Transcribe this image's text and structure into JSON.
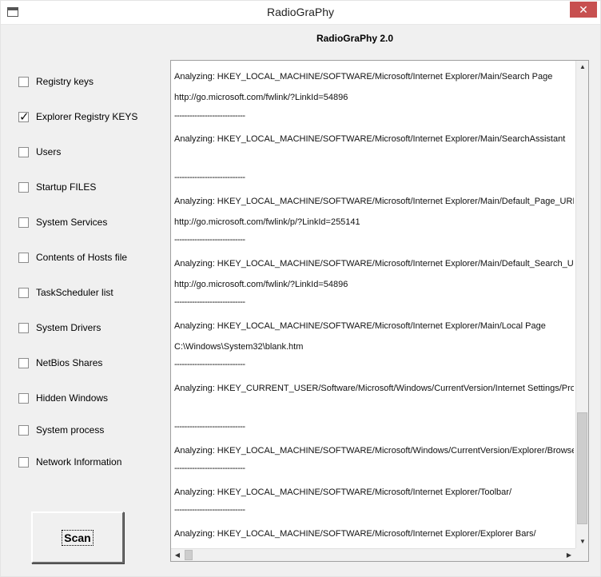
{
  "window": {
    "title": "RadioGraPhy",
    "close_glyph": "✕",
    "icon": "window-icon"
  },
  "header": {
    "title": "RadioGraPhy 2.0"
  },
  "options": [
    {
      "label": "Registry keys",
      "checked": false
    },
    {
      "label": "Explorer Registry KEYS",
      "checked": true
    },
    {
      "label": "Users",
      "checked": false
    },
    {
      "label": "Startup FILES",
      "checked": false
    },
    {
      "label": "System Services",
      "checked": false
    },
    {
      "label": "Contents of Hosts file",
      "checked": false
    },
    {
      "label": "TaskScheduler list",
      "checked": false
    },
    {
      "label": "System Drivers",
      "checked": false
    },
    {
      "label": "NetBios Shares",
      "checked": false
    },
    {
      "label": "Hidden Windows",
      "checked": false
    },
    {
      "label": "System process",
      "checked": false
    },
    {
      "label": "Network Information",
      "checked": false
    }
  ],
  "scan_button": {
    "label": "Scan"
  },
  "output": {
    "lines": [
      "Analyzing: HKEY_LOCAL_MACHINE/SOFTWARE/Microsoft/Internet Explorer/Main/Search Page",
      "http://go.microsoft.com/fwlink/?LinkId=54896",
      "----------------------------",
      "Analyzing: HKEY_LOCAL_MACHINE/SOFTWARE/Microsoft/Internet Explorer/Main/SearchAssistant",
      "",
      "----------------------------",
      "Analyzing: HKEY_LOCAL_MACHINE/SOFTWARE/Microsoft/Internet Explorer/Main/Default_Page_URL",
      "http://go.microsoft.com/fwlink/p/?LinkId=255141",
      "----------------------------",
      "Analyzing: HKEY_LOCAL_MACHINE/SOFTWARE/Microsoft/Internet Explorer/Main/Default_Search_URL",
      "http://go.microsoft.com/fwlink/?LinkId=54896",
      "----------------------------",
      "Analyzing: HKEY_LOCAL_MACHINE/SOFTWARE/Microsoft/Internet Explorer/Main/Local Page",
      "C:\\Windows\\System32\\blank.htm",
      "----------------------------",
      "Analyzing: HKEY_CURRENT_USER/Software/Microsoft/Windows/CurrentVersion/Internet Settings/ProxyServer",
      "",
      "----------------------------",
      "Analyzing: HKEY_LOCAL_MACHINE/SOFTWARE/Microsoft/Windows/CurrentVersion/Explorer/Browser Helper Objects",
      "----------------------------",
      "Analyzing: HKEY_LOCAL_MACHINE/SOFTWARE/Microsoft/Internet Explorer/Toolbar/",
      "----------------------------",
      "Analyzing: HKEY_LOCAL_MACHINE/SOFTWARE/Microsoft/Internet Explorer/Explorer Bars/"
    ]
  },
  "scrollbars": {
    "up_glyph": "▲",
    "down_glyph": "▼",
    "left_glyph": "◀",
    "right_glyph": "▶"
  }
}
